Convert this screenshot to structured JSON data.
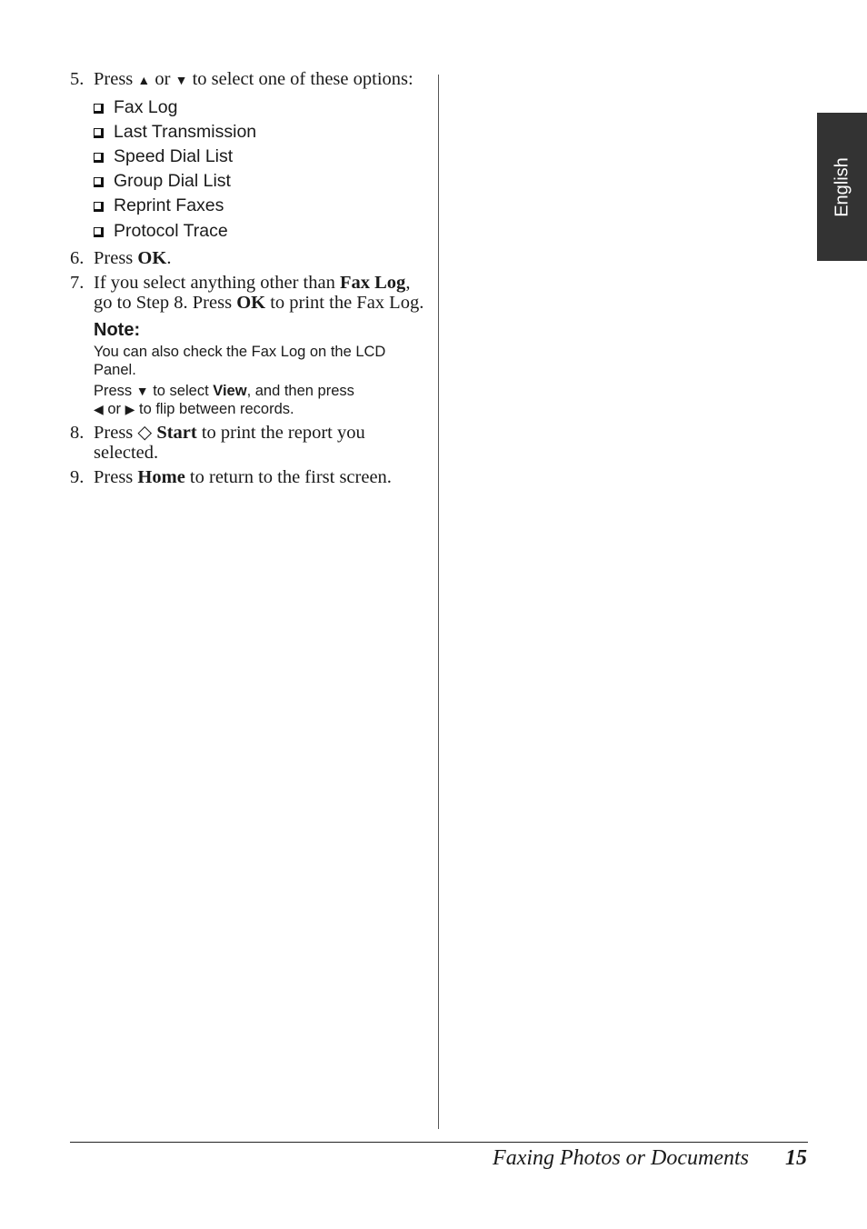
{
  "side_tab": {
    "label": "English"
  },
  "steps": {
    "s5": {
      "num": "5.",
      "t1": "Press ",
      "up": "▲",
      "t2": " or ",
      "down": "▼",
      "t3": " to select one of these options:"
    },
    "options": [
      "Fax Log",
      "Last Transmission",
      "Speed Dial List",
      "Group Dial List",
      "Reprint Faxes",
      "Protocol Trace"
    ],
    "s6": {
      "num": "6.",
      "t1": "Press ",
      "b1": "OK",
      "t2": "."
    },
    "s7": {
      "num": "7.",
      "t1": "If you select anything other than ",
      "b1": "Fax Log",
      "t2": ", go to Step 8. Press ",
      "b2": "OK",
      "t3": " to print the Fax Log."
    },
    "note": {
      "title": "Note:",
      "p1": "You can also check the Fax Log on the LCD Panel.",
      "p2_t1": "Press ",
      "p2_down": "▼",
      "p2_t2": " to select ",
      "p2_b1": "View",
      "p2_t3": ", and then press ",
      "p2_left": "◀",
      "p2_t4": " or ",
      "p2_right": "▶",
      "p2_t5": " to flip between records."
    },
    "s8": {
      "num": "8.",
      "t1": "Press ",
      "icon": "◇",
      "b1": "Start",
      "t2": " to print the report you selected."
    },
    "s9": {
      "num": "9.",
      "t1": "Press ",
      "b1": "Home",
      "t2": " to return to the first screen."
    }
  },
  "footer": {
    "title": "Faxing Photos or Documents",
    "page": "15"
  }
}
